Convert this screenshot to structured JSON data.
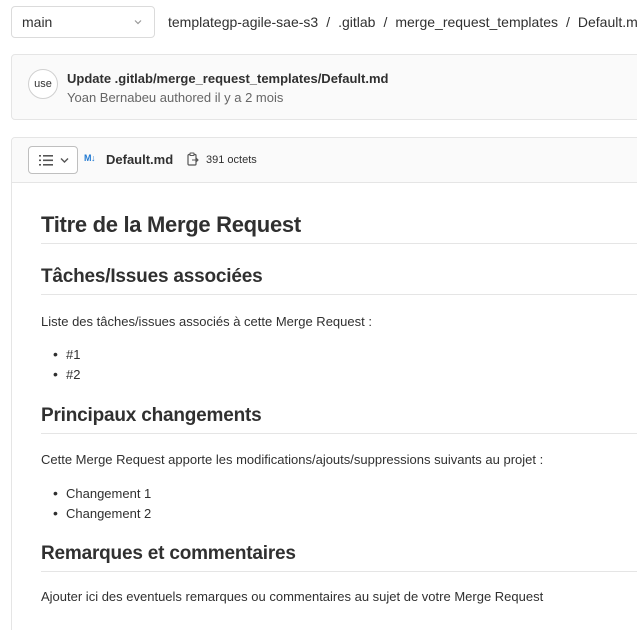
{
  "branch": {
    "name": "main"
  },
  "breadcrumb": [
    "templategp-agile-sae-s3",
    ".gitlab",
    "merge_request_templates",
    "Default.md"
  ],
  "breadcrumb_separator": "/",
  "commit": {
    "avatar_text": "use",
    "title": "Update .gitlab/merge_request_templates/Default.md",
    "author": "Yoan Bernabeu",
    "meta_suffix": "authored il y a 2 mois"
  },
  "file": {
    "type_icon": "M↓",
    "name": "Default.md",
    "size": "391 octets"
  },
  "content": {
    "h1": "Titre de la Merge Request",
    "sections": [
      {
        "heading": "Tâches/Issues associées",
        "text": "Liste des tâches/issues associés à cette Merge Request :",
        "items": [
          "#1",
          "#2"
        ]
      },
      {
        "heading": "Principaux changements",
        "text": "Cette Merge Request apporte les modifications/ajouts/suppressions suivants au projet :",
        "items": [
          "Changement 1",
          "Changement 2"
        ]
      },
      {
        "heading": "Remarques et commentaires",
        "text": "Ajouter ici des eventuels remarques ou commentaires au sujet de votre Merge Request",
        "items": []
      }
    ]
  },
  "icons": {
    "branch_dropdown": "chevron-down-icon",
    "toc": "list-icon",
    "copy": "copy-icon",
    "markdown": "markdown-icon"
  },
  "colors": {
    "link_blue": "#1f78d1",
    "text": "#303030",
    "border": "#e5e5e5"
  }
}
